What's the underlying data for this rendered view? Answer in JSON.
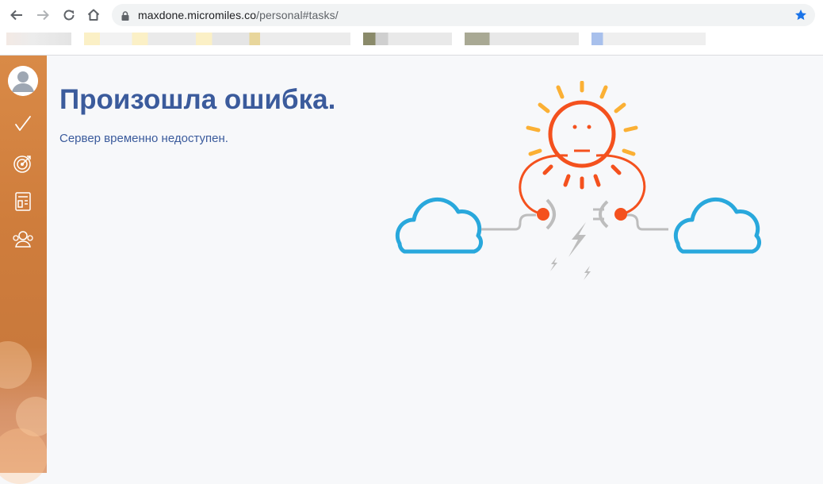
{
  "browser": {
    "url_host": "maxdone.micromiles.co",
    "url_path": "/personal#tasks/",
    "icons": [
      "back-icon",
      "forward-icon",
      "reload-icon",
      "home-icon",
      "lock-icon",
      "bookmark-star-icon"
    ],
    "accent": "#1a73e8"
  },
  "sidebar": {
    "items": [
      {
        "name": "avatar",
        "icon": "user-avatar-icon"
      },
      {
        "name": "tasks",
        "icon": "checkmark-icon"
      },
      {
        "name": "goals",
        "icon": "target-icon"
      },
      {
        "name": "dashboard",
        "icon": "layout-icon"
      },
      {
        "name": "team",
        "icon": "people-icon"
      }
    ]
  },
  "error": {
    "title": "Произошла ошибка.",
    "message": "Сервер временно недоступен."
  },
  "colors": {
    "title": "#3b5b9c",
    "sun": "#f4511e",
    "rays": "#fbb034",
    "cloud": "#29a8dc",
    "plug": "#bdbdbd"
  }
}
